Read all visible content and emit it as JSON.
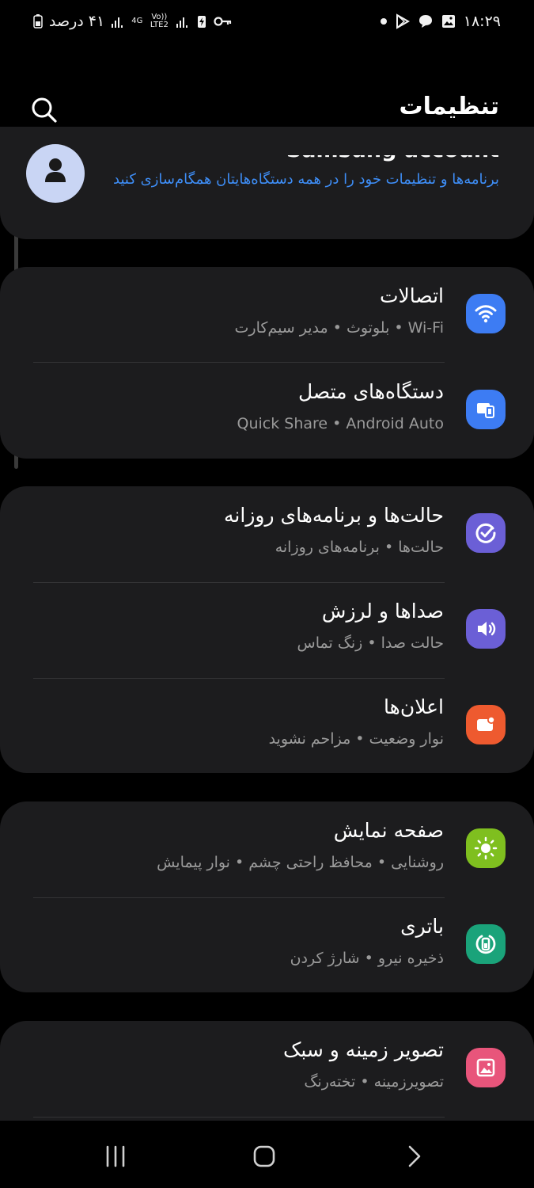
{
  "status_bar": {
    "time": "۱۸:۲۹",
    "battery_text": "۴۱ درصد",
    "network_4g": "4G",
    "volte": "Vo)) LTE2"
  },
  "header": {
    "title": "تنظیمات"
  },
  "account": {
    "title": "Samsung account",
    "description": "برنامه‌ها و تنظیمات خود را در همه دستگاه‌هایتان همگام‌سازی کنید"
  },
  "groups": [
    {
      "items": [
        {
          "title": "اتصالات",
          "subtitle": "Wi-Fi  •  بلوتوث  •  مدیر سیم‌کارت",
          "icon": "wifi-icon",
          "color": "#3d7cf3"
        },
        {
          "title": "دستگاه‌های متصل",
          "subtitle": "Quick Share  •  Android Auto",
          "icon": "connected-devices-icon",
          "color": "#3d7cf3"
        }
      ]
    },
    {
      "items": [
        {
          "title": "حالت‌ها و برنامه‌های روزانه",
          "subtitle": "حالت‌ها  •  برنامه‌های روزانه",
          "icon": "check-circle-icon",
          "color": "#6b5fd6"
        },
        {
          "title": "صداها و لرزش",
          "subtitle": "حالت صدا  •  زنگ تماس",
          "icon": "speaker-icon",
          "color": "#6b5fd6"
        },
        {
          "title": "اعلان‌ها",
          "subtitle": "نوار وضعیت  •  مزاحم نشوید",
          "icon": "notification-icon",
          "color": "#ee5a2f"
        }
      ]
    },
    {
      "items": [
        {
          "title": "صفحه نمایش",
          "subtitle": "روشنایی  •  محافظ راحتی چشم  •  نوار پیمایش",
          "icon": "brightness-icon",
          "color": "#7fbf1f"
        },
        {
          "title": "باتری",
          "subtitle": "ذخیره نیرو  •  شارژ کردن",
          "icon": "battery-icon",
          "color": "#1aa37a"
        }
      ]
    },
    {
      "items": [
        {
          "title": "تصویر زمینه و سبک",
          "subtitle": "تصویرزمینه  •  تخته‌رنگ",
          "icon": "wallpaper-icon",
          "color": "#e8557b"
        }
      ]
    }
  ]
}
